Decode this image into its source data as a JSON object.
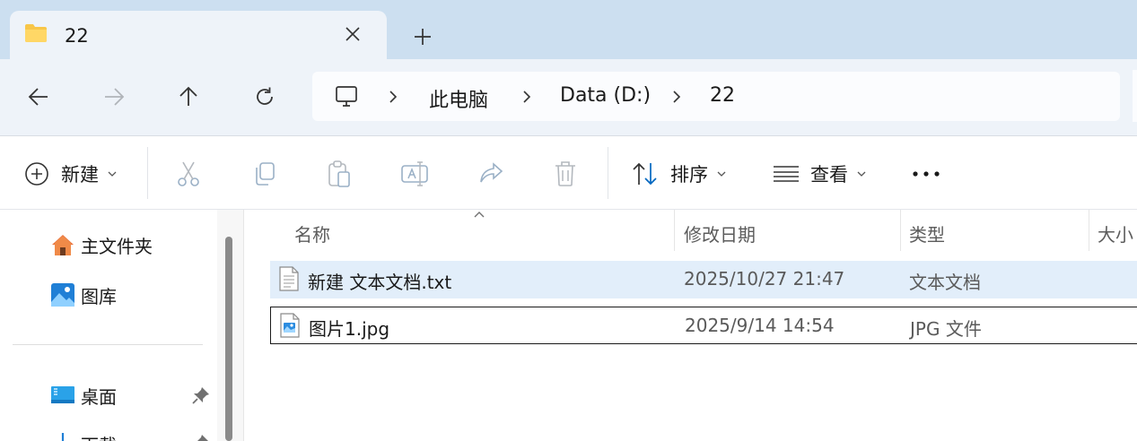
{
  "tab": {
    "title": "22",
    "icon": "folder-icon"
  },
  "new_tab": {
    "icon": "plus-icon"
  },
  "nav": {
    "back_icon": "arrow-left-icon",
    "forward_icon": "arrow-right-icon",
    "up_icon": "arrow-up-icon",
    "refresh_icon": "refresh-icon"
  },
  "address": {
    "root_icon": "computer-icon",
    "crumbs": [
      "此电脑",
      "Data (D:)",
      "22"
    ]
  },
  "toolbar": {
    "new_label": "新建",
    "sort_label": "排序",
    "view_label": "查看",
    "more_label": "•••"
  },
  "sidebar": {
    "items": [
      {
        "label": "主文件夹",
        "icon": "home-icon"
      },
      {
        "label": "图库",
        "icon": "gallery-icon"
      },
      {
        "label": "桌面",
        "icon": "desktop-icon"
      },
      {
        "label": "下载",
        "icon": "download-icon"
      }
    ]
  },
  "columns": [
    "名称",
    "修改日期",
    "类型",
    "大小"
  ],
  "files": [
    {
      "name": "新建 文本文档.txt",
      "modified": "2025/10/27 21:47",
      "type": "文本文档",
      "icon": "text-file-icon"
    },
    {
      "name": "图片1.jpg",
      "modified": "2025/9/14 14:54",
      "type": "JPG 文件",
      "icon": "image-file-icon"
    }
  ],
  "colors": {
    "accent": "#0067c0",
    "tabbar": "#ccdff0",
    "navbar": "#eef3f9",
    "selection": "#e2eefa"
  }
}
